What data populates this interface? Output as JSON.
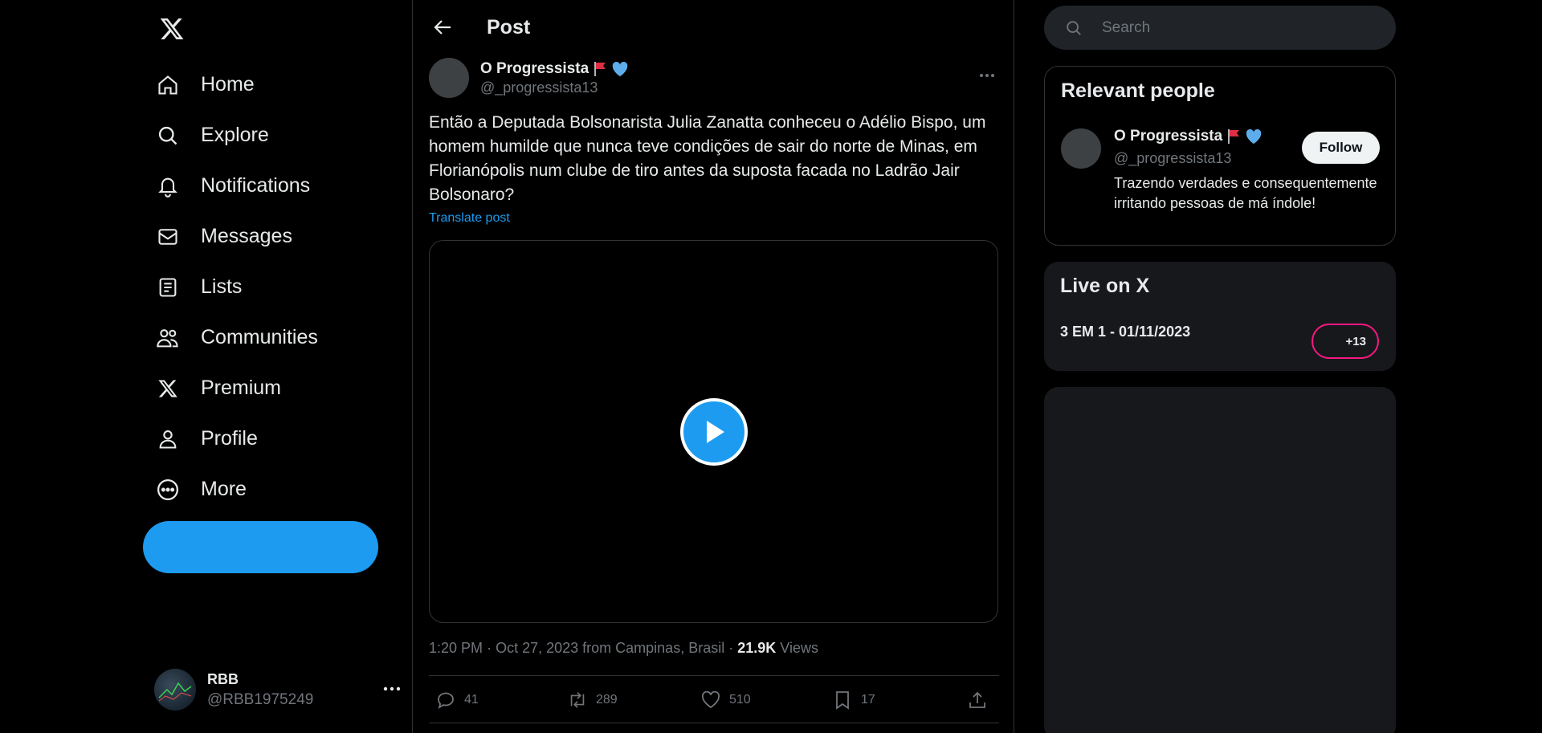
{
  "nav": {
    "logo_icon": "x-logo-icon",
    "items": [
      {
        "label": "Home",
        "icon": "home-icon"
      },
      {
        "label": "Explore",
        "icon": "search-icon"
      },
      {
        "label": "Notifications",
        "icon": "bell-icon"
      },
      {
        "label": "Messages",
        "icon": "envelope-icon"
      },
      {
        "label": "Lists",
        "icon": "list-icon"
      },
      {
        "label": "Communities",
        "icon": "communities-icon"
      },
      {
        "label": "Premium",
        "icon": "x-logo-icon"
      },
      {
        "label": "Profile",
        "icon": "person-icon"
      },
      {
        "label": "More",
        "icon": "more-circle-icon"
      }
    ],
    "post_button_label": "",
    "account": {
      "name": "RBB",
      "handle": "@RBB1975249"
    }
  },
  "header": {
    "title": "Post"
  },
  "post": {
    "author_name": "O Progressista",
    "author_handle": "@_progressista13",
    "text": "Então a Deputada Bolsonarista Julia Zanatta conheceu o Adélio Bispo, um homem humilde que nunca teve condições de sair do norte de Minas, em Florianópolis num clube de tiro antes da suposta facada no Ladrão Jair Bolsonaro?",
    "translate_label": "Translate post",
    "time": "1:20 PM",
    "date": "Oct 27, 2023",
    "location": "from Campinas, Brasil",
    "views_count": "21.9K",
    "views_label": "Views",
    "replies": "41",
    "reposts": "289",
    "likes": "510",
    "bookmarks": "17"
  },
  "search": {
    "placeholder": "Search"
  },
  "relevant_people": {
    "title": "Relevant people",
    "name": "O Progressista",
    "handle": "@_progressista13",
    "bio": "Trazendo verdades e consequentemente irritando pessoas de má índole!",
    "follow_label": "Follow"
  },
  "live": {
    "title": "Live on X",
    "item": "3 EM 1 - 01/11/2023",
    "count": "+13"
  },
  "colors": {
    "accent": "#1d9bf0",
    "live": "#f91880",
    "background": "#000000"
  }
}
